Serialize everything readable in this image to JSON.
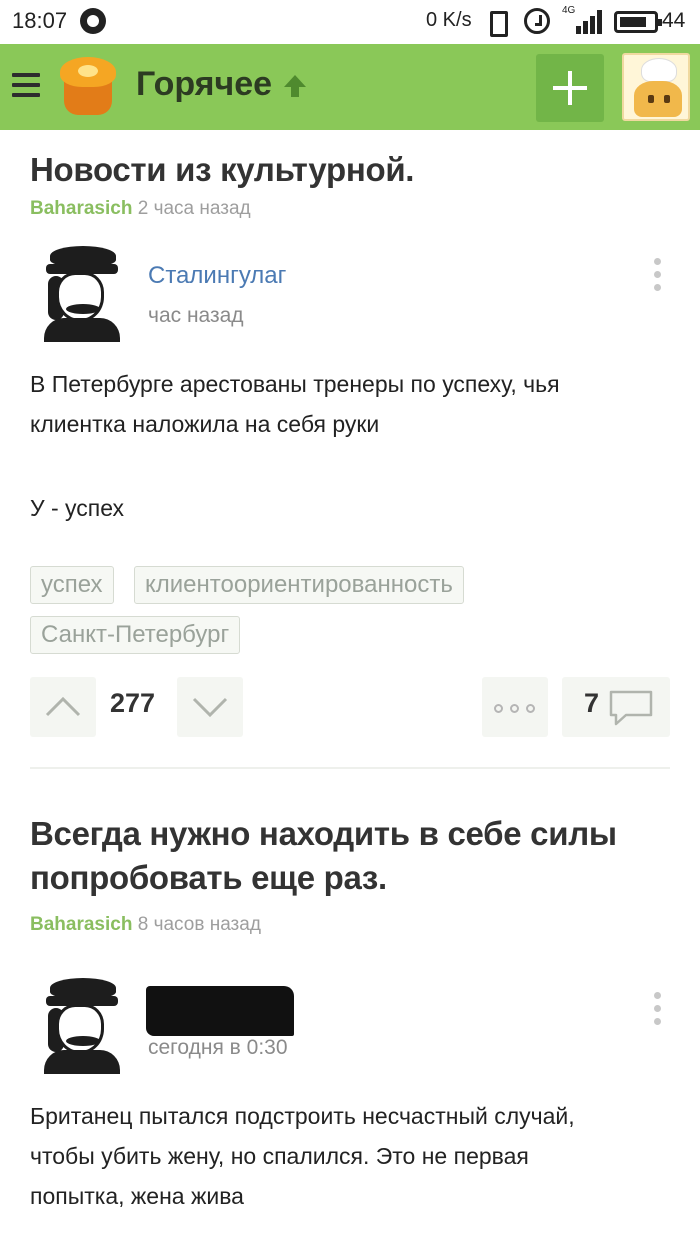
{
  "status_bar": {
    "time": "18:07",
    "speed": "0 K/s",
    "signal_label": "4G",
    "battery": "44"
  },
  "header": {
    "title": "Горячее",
    "colors": {
      "bar": "#8ac858",
      "plus_button": "#72b548"
    }
  },
  "posts": [
    {
      "title": "Новости из культурной.",
      "author": "Baharasich",
      "time": "2 часа назад",
      "comment": {
        "user": "Сталингулаг",
        "time": "час назад",
        "text_lines": [
          "В Петербурге арестованы тренеры по успеху, чья",
          "клиентка наложила на себя руки"
        ],
        "text_extra": "У - успех"
      },
      "tags": [
        "успех",
        "клиентоориентированность",
        "Санкт-Петербург"
      ],
      "rating": "277",
      "comments_count": "7"
    },
    {
      "title_lines": [
        "Всегда нужно находить в себе силы",
        "попробовать еще раз."
      ],
      "author": "Baharasich",
      "time": "8 часов назад",
      "comment": {
        "time": "сегодня в 0:30",
        "text_lines": [
          "Британец пытался подстроить несчастный случай,",
          "чтобы убить жену, но спалился. Это не первая",
          "попытка, жена жива"
        ]
      }
    }
  ]
}
